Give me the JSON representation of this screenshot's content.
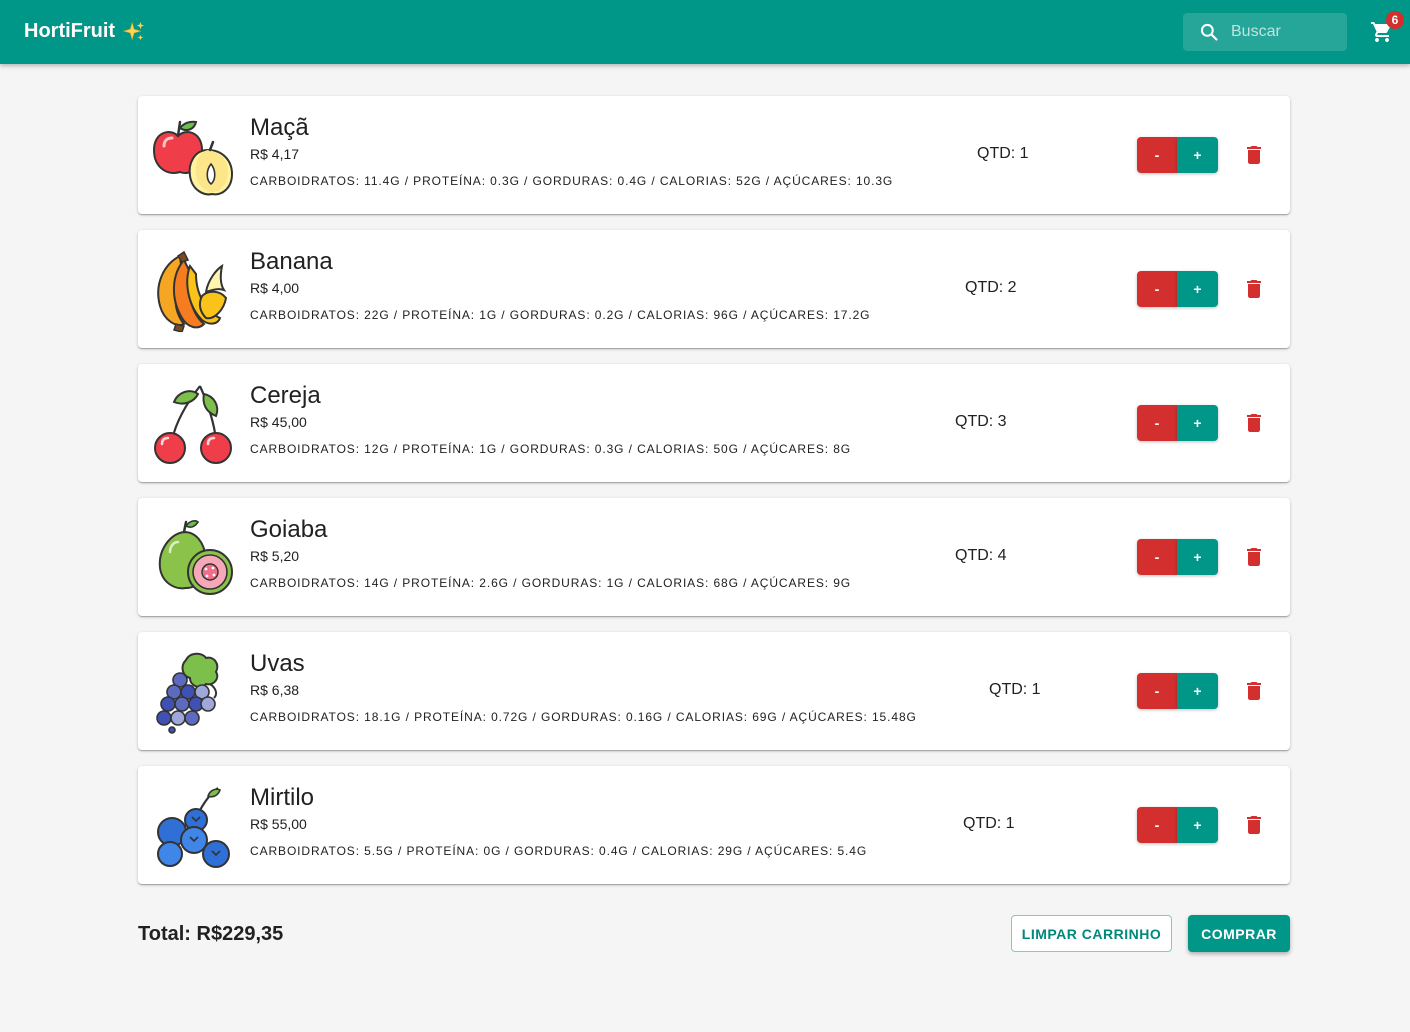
{
  "header": {
    "title": "HortiFruit",
    "search_placeholder": "Buscar",
    "cart_count": "6",
    "bar_color": "#009688"
  },
  "cart": {
    "items": [
      {
        "name": "Maçã",
        "price": "R$ 4,17",
        "nutrition": "Carboidratos: 11.4g / Proteína: 0.3g / Gorduras: 0.4g / Calorias: 52g / Açúcares: 10.3g",
        "qty": "QTD: 1",
        "icon": "apple-icon"
      },
      {
        "name": "Banana",
        "price": "R$ 4,00",
        "nutrition": "Carboidratos: 22g / Proteína: 1g / Gorduras: 0.2g / Calorias: 96g / Açúcares: 17.2g",
        "qty": "QTD: 2",
        "icon": "banana-icon"
      },
      {
        "name": "Cereja",
        "price": "R$ 45,00",
        "nutrition": "Carboidratos: 12g / Proteína: 1g / Gorduras: 0.3g / Calorias: 50g / Açúcares: 8g",
        "qty": "QTD: 3",
        "icon": "cherry-icon"
      },
      {
        "name": "Goiaba",
        "price": "R$ 5,20",
        "nutrition": "Carboidratos: 14g / Proteína: 2.6g / Gorduras: 1g / Calorias: 68g / Açúcares: 9g",
        "qty": "QTD: 4",
        "icon": "guava-icon"
      },
      {
        "name": "Uvas",
        "price": "R$ 6,38",
        "nutrition": "Carboidratos: 18.1g / Proteína: 0.72g / Gorduras: 0.16g / Calorias: 69g / Açúcares: 15.48g",
        "qty": "QTD: 1",
        "icon": "grapes-icon"
      },
      {
        "name": "Mirtilo",
        "price": "R$ 55,00",
        "nutrition": "Carboidratos: 5.5g / Proteína: 0g / Gorduras: 0.4g / Calorias: 29g / Açúcares: 5.4g",
        "qty": "QTD: 1",
        "icon": "blueberry-icon"
      }
    ],
    "minus_label": "-",
    "plus_label": "+",
    "total": "Total: R$229,35",
    "clear_label": "LIMPAR CARRINHO",
    "buy_label": "COMPRAR",
    "colors": {
      "primary": "#009688",
      "danger": "#d32f2f"
    }
  }
}
